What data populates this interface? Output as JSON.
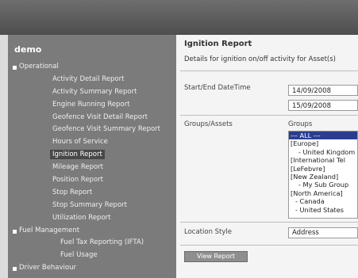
{
  "sidebar": {
    "user": "demo",
    "groups": [
      {
        "label": "Operational",
        "items": [
          "Activity Detail Report",
          "Activity Summary Report",
          "Engine Running Report",
          "Geofence Visit Detail Report",
          "Geofence Visit Summary Report",
          "Hours of Service",
          "Ignition Report",
          "Mileage Report",
          "Position Report",
          "Stop Report",
          "Stop Summary Report",
          "Utilization Report"
        ]
      },
      {
        "label": "Fuel Management",
        "items": [
          "Fuel Tax Reporting (IFTA)",
          "Fuel Usage"
        ]
      },
      {
        "label": "Driver Behaviour",
        "items": []
      }
    ]
  },
  "content": {
    "title": "Ignition Report",
    "description": "Details for ignition on/off activity for Asset(s)",
    "start_end_label": "Start/End DateTime",
    "start_date": "14/09/2008",
    "end_date": "15/09/2008",
    "groups_label": "Groups/Assets",
    "groups_caption": "Groups",
    "group_options": [
      "--- ALL ---",
      "[Europe]",
      "- United Kingdom",
      "[International Tel",
      "[LeFebvre]",
      "[New Zealand]",
      "- My Sub Group",
      "[North America]",
      "- Canada",
      "- United States"
    ],
    "location_label": "Location Style",
    "location_value": "Address",
    "view_button": "View Report"
  }
}
